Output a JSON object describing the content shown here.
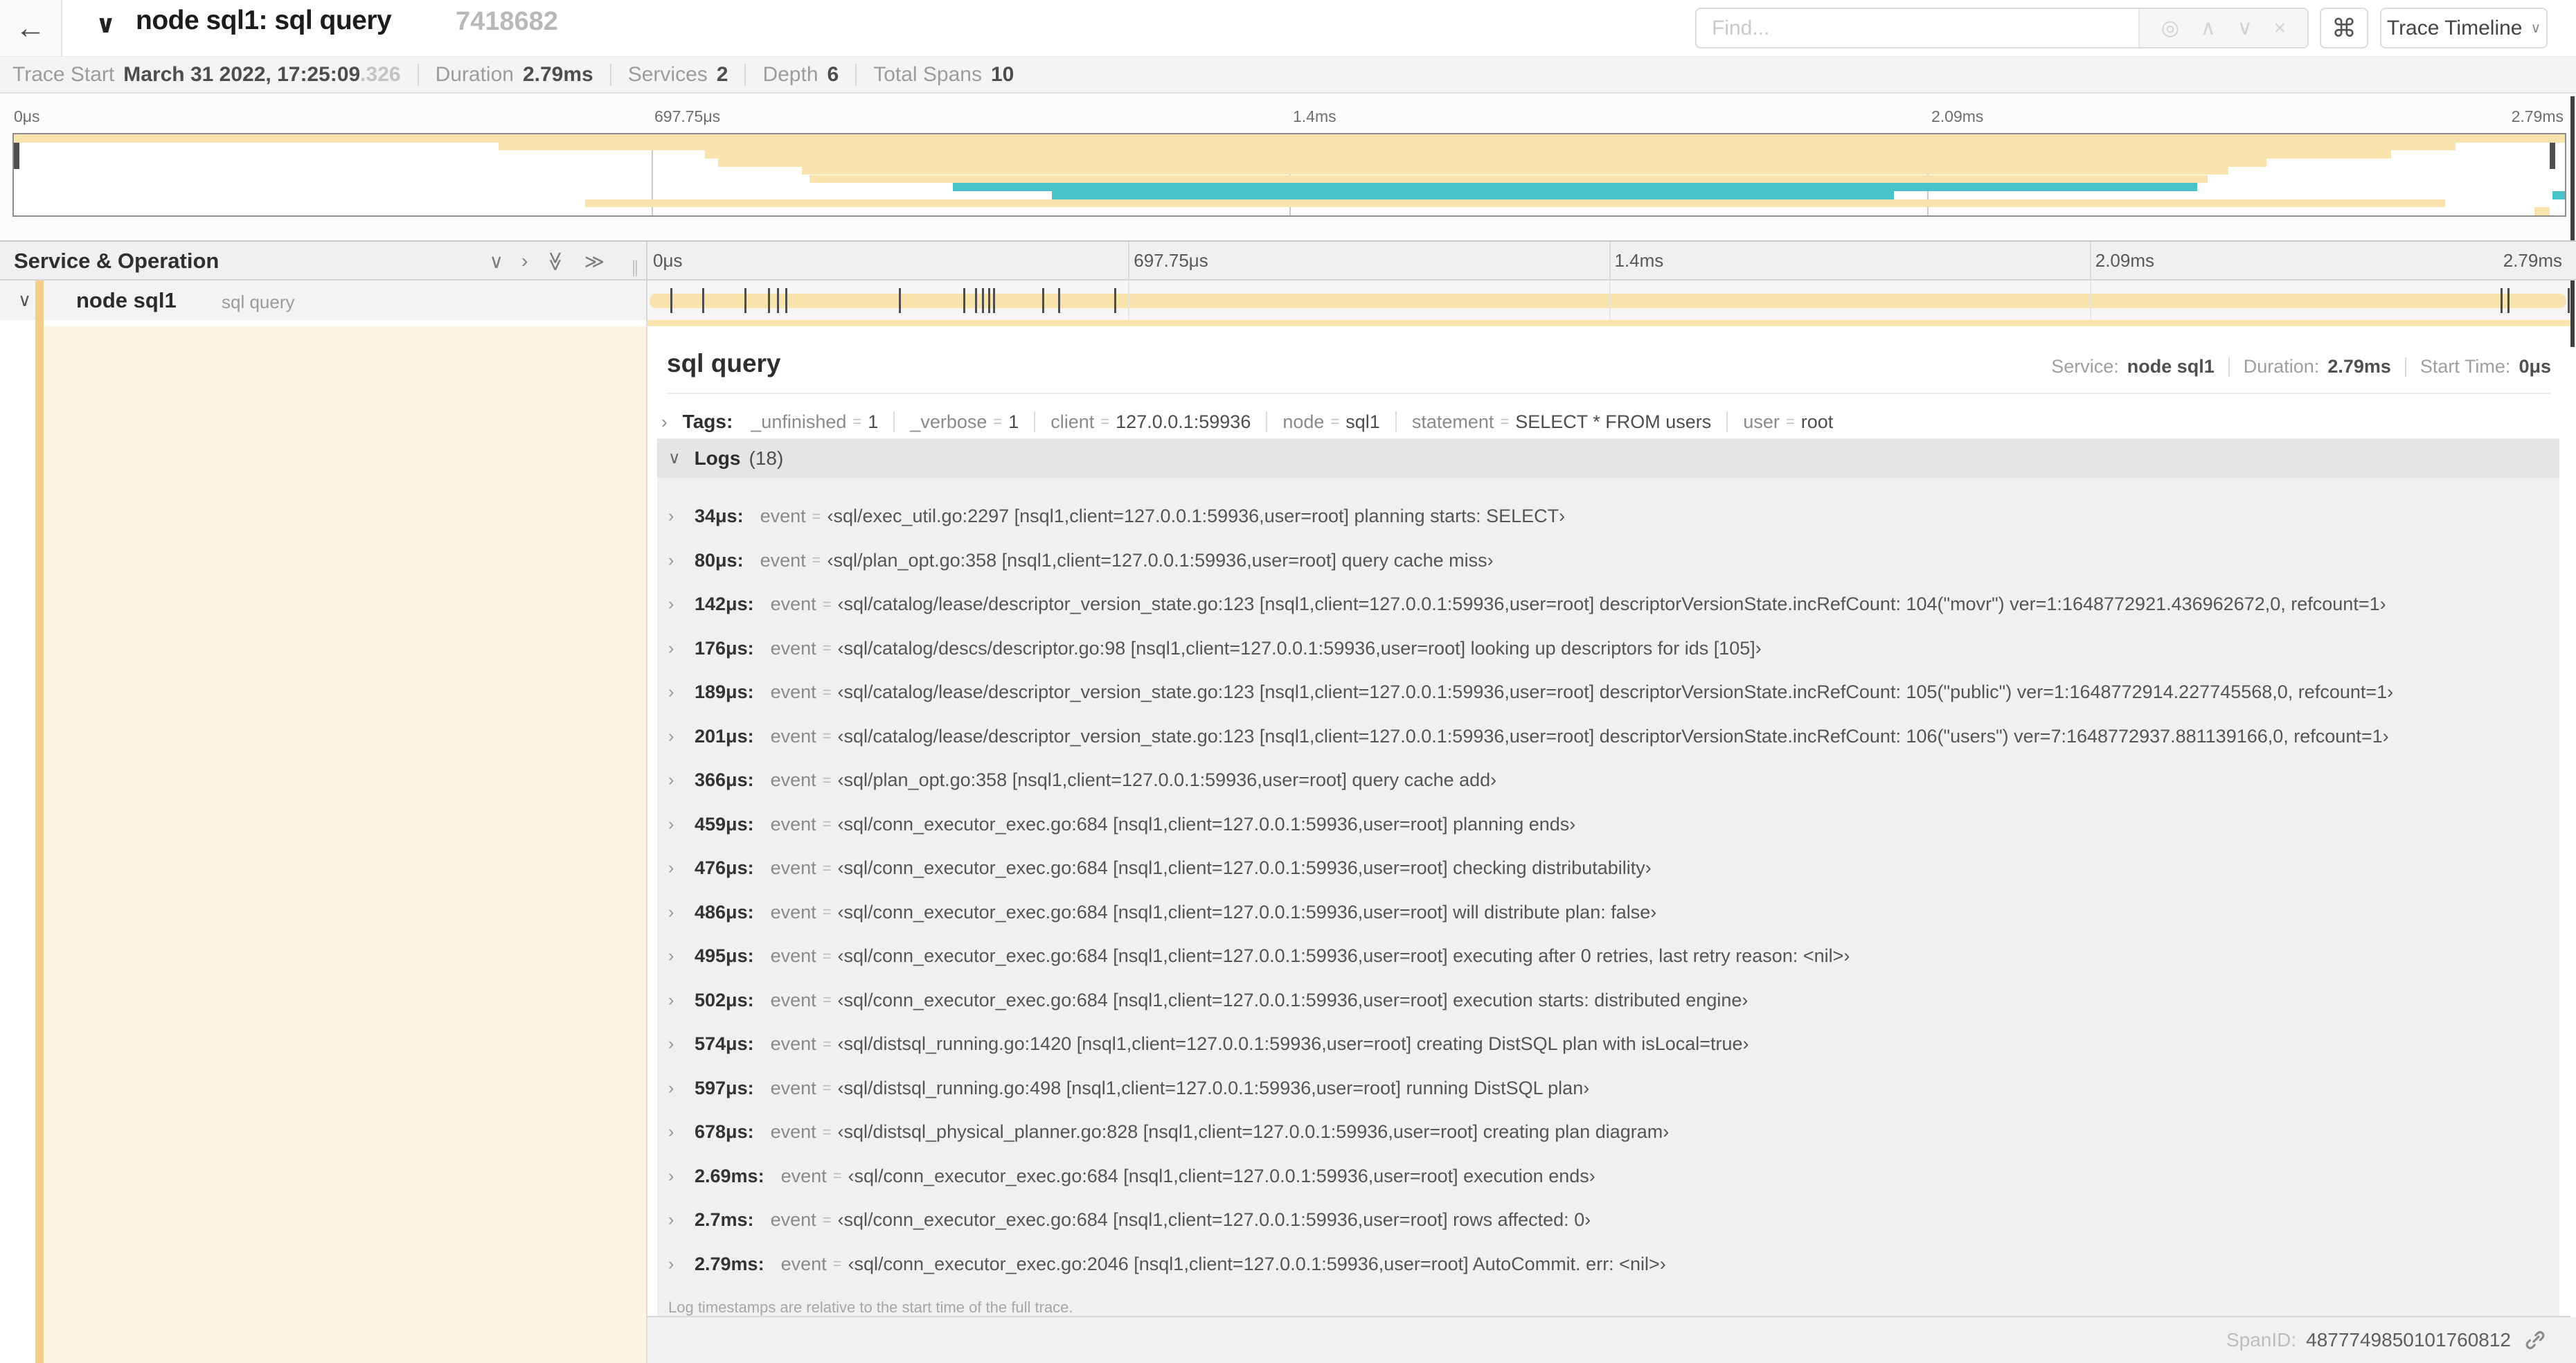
{
  "icons": {
    "back_arrow": "←",
    "chevron_down": "∨",
    "chevron_right": "›",
    "double_chevron": "≫",
    "target": "◎",
    "chevron_up": "∧",
    "close": "×",
    "command": "⌘",
    "grip": "∥",
    "eq": "="
  },
  "colors": {
    "tan": "#f9e4af",
    "tan_strip": "#f3cf8d",
    "teal": "#48c3c7",
    "cream": "#fdf4e3"
  },
  "topbar": {
    "title": "node sql1: sql query",
    "trace_id": "7418682",
    "find_placeholder": "Find...",
    "view_select_label": "Trace Timeline"
  },
  "info_bar": {
    "items": [
      {
        "label": "Trace Start",
        "value": "March 31 2022, 17:25:09",
        "suffix": ".326"
      },
      {
        "label": "Duration",
        "value": "2.79ms",
        "suffix": ""
      },
      {
        "label": "Services",
        "value": "2",
        "suffix": ""
      },
      {
        "label": "Depth",
        "value": "6",
        "suffix": ""
      },
      {
        "label": "Total Spans",
        "value": "10",
        "suffix": ""
      }
    ]
  },
  "timeline": {
    "ticks": [
      {
        "label": "0μs",
        "pct": 0
      },
      {
        "label": "697.75μs",
        "pct": 25
      },
      {
        "label": "1.4ms",
        "pct": 50
      },
      {
        "label": "2.09ms",
        "pct": 75
      },
      {
        "label": "2.79ms",
        "pct": 100
      }
    ],
    "duration_us": 2790,
    "log_marker_times_us": [
      34,
      80,
      142,
      176,
      189,
      201,
      366,
      459,
      476,
      486,
      495,
      502,
      574,
      597,
      678,
      2690,
      2700,
      2790
    ]
  },
  "minimap": {
    "spans": [
      {
        "row": 0,
        "start_pct": 0,
        "end_pct": 100,
        "color": "tan"
      },
      {
        "row": 1,
        "start_pct": 19,
        "end_pct": 95.7,
        "color": "tan"
      },
      {
        "row": 2,
        "start_pct": 27.1,
        "end_pct": 93.2,
        "color": "tan"
      },
      {
        "row": 3,
        "start_pct": 27.6,
        "end_pct": 88.3,
        "color": "tan"
      },
      {
        "row": 4,
        "start_pct": 30.9,
        "end_pct": 86.8,
        "color": "tan"
      },
      {
        "row": 5,
        "start_pct": 31.2,
        "end_pct": 86.0,
        "color": "tan"
      },
      {
        "row": 6,
        "start_pct": 36.8,
        "end_pct": 85.6,
        "color": "teal"
      },
      {
        "row": 7,
        "start_pct": 40.7,
        "end_pct": 73.7,
        "color": "teal"
      },
      {
        "row": 7,
        "start_pct": 99.5,
        "end_pct": 100,
        "color": "teal"
      },
      {
        "row": 8,
        "start_pct": 22.4,
        "end_pct": 95.3,
        "color": "tan"
      },
      {
        "row": 9,
        "start_pct": 98.8,
        "end_pct": 99.4,
        "color": "tan"
      }
    ]
  },
  "grid_header": {
    "title": "Service & Operation"
  },
  "span_row": {
    "service": "node sql1",
    "operation": "sql query"
  },
  "detail": {
    "title": "sql query",
    "meta": [
      {
        "label": "Service:",
        "value": "node sql1"
      },
      {
        "label": "Duration:",
        "value": "2.79ms"
      },
      {
        "label": "Start Time:",
        "value": "0μs"
      }
    ],
    "tags_label": "Tags:",
    "tags": [
      {
        "key": "_unfinished",
        "value": "1"
      },
      {
        "key": "_verbose",
        "value": "1"
      },
      {
        "key": "client",
        "value": "127.0.0.1:59936"
      },
      {
        "key": "node",
        "value": "sql1"
      },
      {
        "key": "statement",
        "value": "SELECT * FROM users"
      },
      {
        "key": "user",
        "value": "root"
      }
    ],
    "logs_label": "Logs",
    "logs_count": "(18)",
    "logs": [
      {
        "time": "34μs:",
        "key": "event",
        "value": "‹sql/exec_util.go:2297 [nsql1,client=127.0.0.1:59936,user=root] planning starts: SELECT›"
      },
      {
        "time": "80μs:",
        "key": "event",
        "value": "‹sql/plan_opt.go:358 [nsql1,client=127.0.0.1:59936,user=root] query cache miss›"
      },
      {
        "time": "142μs:",
        "key": "event",
        "value": "‹sql/catalog/lease/descriptor_version_state.go:123 [nsql1,client=127.0.0.1:59936,user=root] descriptorVersionState.incRefCount: 104(\"movr\") ver=1:1648772921.436962672,0, refcount=1›"
      },
      {
        "time": "176μs:",
        "key": "event",
        "value": "‹sql/catalog/descs/descriptor.go:98 [nsql1,client=127.0.0.1:59936,user=root] looking up descriptors for ids [105]›"
      },
      {
        "time": "189μs:",
        "key": "event",
        "value": "‹sql/catalog/lease/descriptor_version_state.go:123 [nsql1,client=127.0.0.1:59936,user=root] descriptorVersionState.incRefCount: 105(\"public\") ver=1:1648772914.227745568,0, refcount=1›"
      },
      {
        "time": "201μs:",
        "key": "event",
        "value": "‹sql/catalog/lease/descriptor_version_state.go:123 [nsql1,client=127.0.0.1:59936,user=root] descriptorVersionState.incRefCount: 106(\"users\") ver=7:1648772937.881139166,0, refcount=1›"
      },
      {
        "time": "366μs:",
        "key": "event",
        "value": "‹sql/plan_opt.go:358 [nsql1,client=127.0.0.1:59936,user=root] query cache add›"
      },
      {
        "time": "459μs:",
        "key": "event",
        "value": "‹sql/conn_executor_exec.go:684 [nsql1,client=127.0.0.1:59936,user=root] planning ends›"
      },
      {
        "time": "476μs:",
        "key": "event",
        "value": "‹sql/conn_executor_exec.go:684 [nsql1,client=127.0.0.1:59936,user=root] checking distributability›"
      },
      {
        "time": "486μs:",
        "key": "event",
        "value": "‹sql/conn_executor_exec.go:684 [nsql1,client=127.0.0.1:59936,user=root] will distribute plan: false›"
      },
      {
        "time": "495μs:",
        "key": "event",
        "value": "‹sql/conn_executor_exec.go:684 [nsql1,client=127.0.0.1:59936,user=root] executing after 0 retries, last retry reason: <nil>›"
      },
      {
        "time": "502μs:",
        "key": "event",
        "value": "‹sql/conn_executor_exec.go:684 [nsql1,client=127.0.0.1:59936,user=root] execution starts: distributed engine›"
      },
      {
        "time": "574μs:",
        "key": "event",
        "value": "‹sql/distsql_running.go:1420 [nsql1,client=127.0.0.1:59936,user=root] creating DistSQL plan with isLocal=true›"
      },
      {
        "time": "597μs:",
        "key": "event",
        "value": "‹sql/distsql_running.go:498 [nsql1,client=127.0.0.1:59936,user=root] running DistSQL plan›"
      },
      {
        "time": "678μs:",
        "key": "event",
        "value": "‹sql/distsql_physical_planner.go:828 [nsql1,client=127.0.0.1:59936,user=root] creating plan diagram›"
      },
      {
        "time": "2.69ms:",
        "key": "event",
        "value": "‹sql/conn_executor_exec.go:684 [nsql1,client=127.0.0.1:59936,user=root] execution ends›"
      },
      {
        "time": "2.7ms:",
        "key": "event",
        "value": "‹sql/conn_executor_exec.go:684 [nsql1,client=127.0.0.1:59936,user=root] rows affected: 0›"
      },
      {
        "time": "2.79ms:",
        "key": "event",
        "value": "‹sql/conn_executor_exec.go:2046 [nsql1,client=127.0.0.1:59936,user=root] AutoCommit. err: <nil>›"
      }
    ],
    "footer": "Log timestamps are relative to the start time of the full trace.",
    "span_id_label": "SpanID:",
    "span_id": "4877749850101760812"
  }
}
